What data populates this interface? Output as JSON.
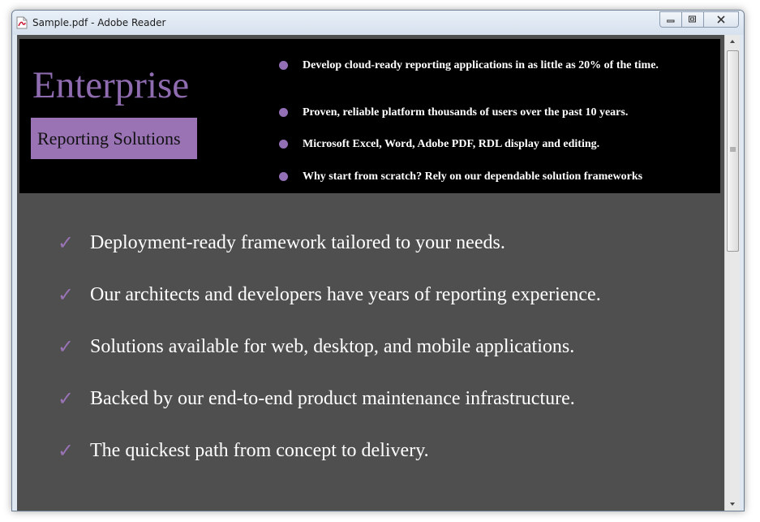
{
  "window": {
    "title": "Sample.pdf - Adobe Reader",
    "icon": "pdf-file-icon",
    "controls": [
      "minimize-icon",
      "restore-icon",
      "close-icon"
    ]
  },
  "document": {
    "brand": {
      "title": "Enterprise",
      "subtitle": "Reporting Solutions"
    },
    "banner_bullets": [
      "Develop cloud-ready reporting applications in as little as 20% of the time.",
      "Proven, reliable platform thousands of users over the past 10 years.",
      "Microsoft Excel, Word, Adobe PDF, RDL display and editing.",
      "Why start from scratch? Rely on our dependable solution frameworks"
    ],
    "check_mark": "✓",
    "checklist": [
      "Deployment-ready framework tailored to your needs.",
      "Our architects and developers have years of reporting experience.",
      "Solutions available for web, desktop, and mobile applications.",
      "Backed by our end-to-end product maintenance infrastructure.",
      "The quickest path from concept to delivery."
    ]
  },
  "colors": {
    "accent_purple": "#9a73b5",
    "banner_bg": "#000000",
    "page_bg": "#4f4f4f"
  }
}
